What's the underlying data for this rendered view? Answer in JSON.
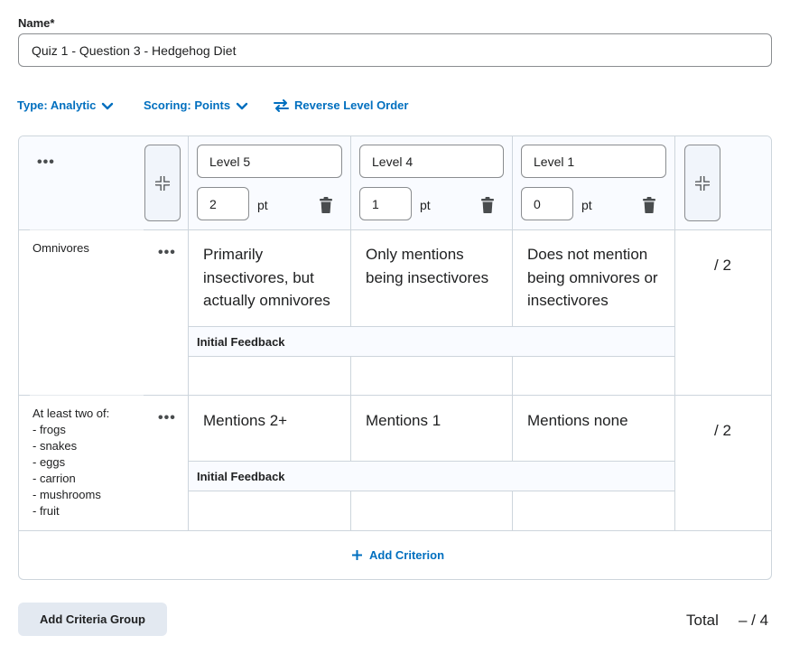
{
  "name_field": {
    "label": "Name*",
    "value": "Quiz 1 - Question 3 - Hedgehog Diet"
  },
  "toolbar": {
    "type_label": "Type: Analytic",
    "scoring_label": "Scoring: Points",
    "reverse_label": "Reverse Level Order"
  },
  "levels": [
    {
      "name": "Level 5",
      "points": "2",
      "unit": "pt"
    },
    {
      "name": "Level 4",
      "points": "1",
      "unit": "pt"
    },
    {
      "name": "Level 1",
      "points": "0",
      "unit": "pt"
    }
  ],
  "criteria": [
    {
      "name": "Omnivores",
      "descriptions": [
        "Primarily insectivores, but actually omnivores",
        "Only mentions being insectivores",
        "Does not mention being omnivores or insectivores"
      ],
      "feedback_label": "Initial Feedback",
      "points": "/ 2"
    },
    {
      "name": "At least two of:\n- frogs\n- snakes\n- eggs\n- carrion\n- mushrooms\n- fruit",
      "descriptions": [
        "Mentions 2+",
        "Mentions 1",
        "Mentions none"
      ],
      "feedback_label": "Initial Feedback",
      "points": "/ 2"
    }
  ],
  "add_criterion_label": "Add Criterion",
  "add_group_label": "Add Criteria Group",
  "total": {
    "label": "Total",
    "value": "– / 4"
  },
  "accent_color": "#006fbf"
}
